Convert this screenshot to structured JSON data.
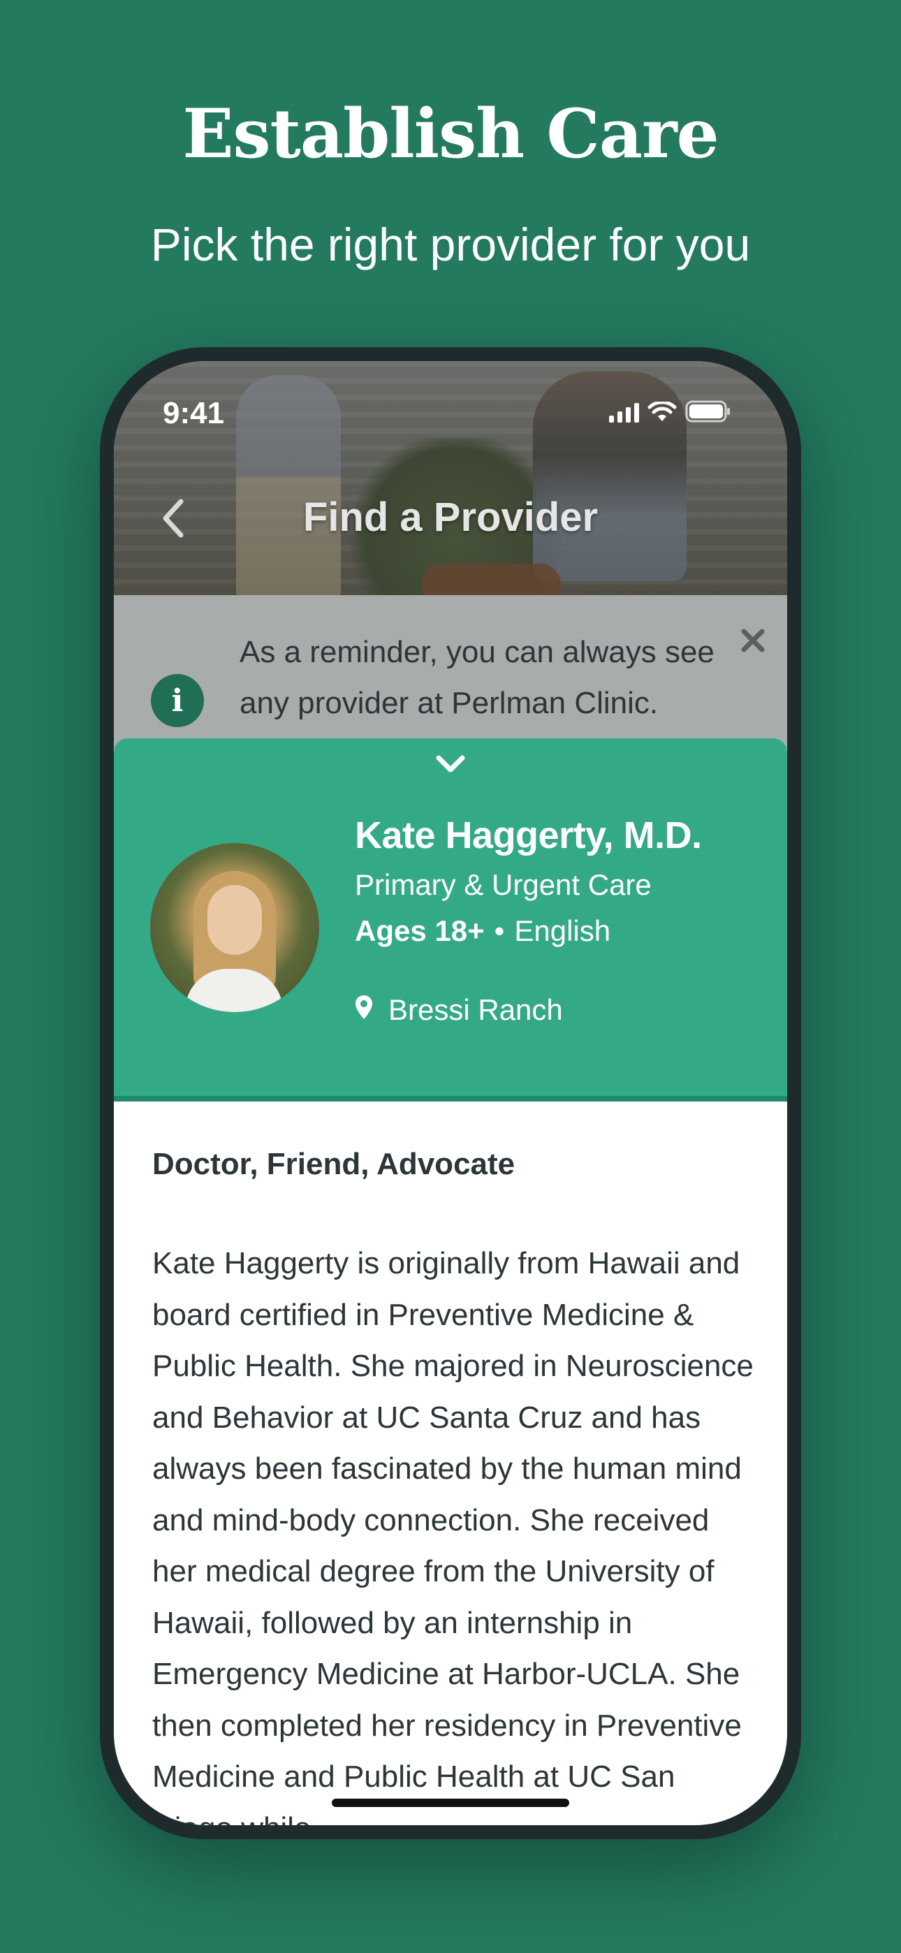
{
  "promo": {
    "title": "Establish Care",
    "subtitle": "Pick the right provider for you"
  },
  "status_bar": {
    "time": "9:41"
  },
  "nav": {
    "title": "Find a Provider"
  },
  "reminder": {
    "text": "As a reminder, you can always see any provider at Perlman Clinic."
  },
  "provider": {
    "name": "Kate Haggerty, M.D.",
    "specialty": "Primary & Urgent Care",
    "ages": "Ages 18+",
    "separator": "•",
    "language": "English",
    "location": "Bressi Ranch"
  },
  "bio": {
    "heading": "Doctor, Friend, Advocate",
    "body": "Kate Haggerty is originally from Hawaii and board certified in Preventive Medicine & Public Health. She majored in Neuroscience and Behavior at UC Santa Cruz and has always been fascinated by the human mind and mind-body connection. She received her medical degree from the University of Hawaii, followed by an internship in Emergency Medicine at Harbor-UCLA. She then completed her residency in Preventive Medicine and Public Health at UC San Diego while"
  },
  "colors": {
    "background": "#237a5f",
    "card": "#34a985",
    "info_icon": "#1f6e55"
  }
}
